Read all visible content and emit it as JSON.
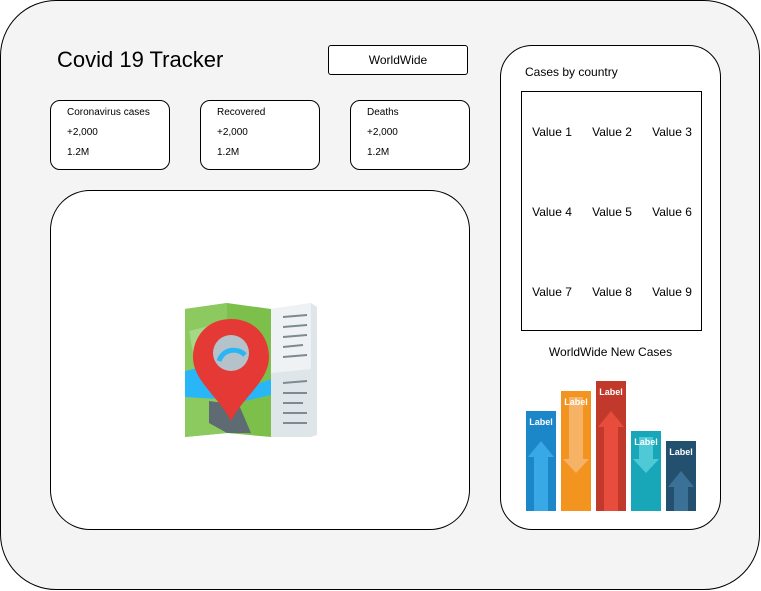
{
  "app": {
    "title": "Covid 19 Tracker"
  },
  "scope_button": {
    "label": "WorldWide"
  },
  "stats": [
    {
      "label": "Coronavirus cases",
      "today": "+2,000",
      "total": "1.2M"
    },
    {
      "label": "Recovered",
      "today": "+2,000",
      "total": "1.2M"
    },
    {
      "label": "Deaths",
      "today": "+2,000",
      "total": "1.2M"
    }
  ],
  "map": {
    "icon": "map-pin-icon",
    "colors": {
      "pin": "#e53935",
      "land": "#7cc04b",
      "water": "#29b6f6",
      "paper": "#dfe6ea"
    }
  },
  "cases_by_country": {
    "title": "Cases by country",
    "values": [
      "Value 1",
      "Value 2",
      "Value 3",
      "Value 4",
      "Value 5",
      "Value 6",
      "Value 7",
      "Value 8",
      "Value 9"
    ]
  },
  "new_cases": {
    "title": "WorldWide New Cases",
    "bar_label": "Label"
  },
  "chart_data": {
    "type": "bar",
    "title": "WorldWide New Cases",
    "series": [
      {
        "values": [
          100,
          120,
          130,
          80,
          70
        ]
      }
    ],
    "categories": [
      "Label",
      "Label",
      "Label",
      "Label",
      "Label"
    ],
    "arrows": [
      "up",
      "down",
      "up",
      "down",
      "up"
    ],
    "colors": [
      "#1b87c9",
      "#f39421",
      "#c0392b",
      "#17a7b8",
      "#24506f"
    ],
    "arrow_colors": [
      "#38a8e6",
      "#f7b365",
      "#e74c3c",
      "#4fc9d6",
      "#3b7196"
    ],
    "ylim": [
      0,
      130
    ],
    "grid": false
  }
}
